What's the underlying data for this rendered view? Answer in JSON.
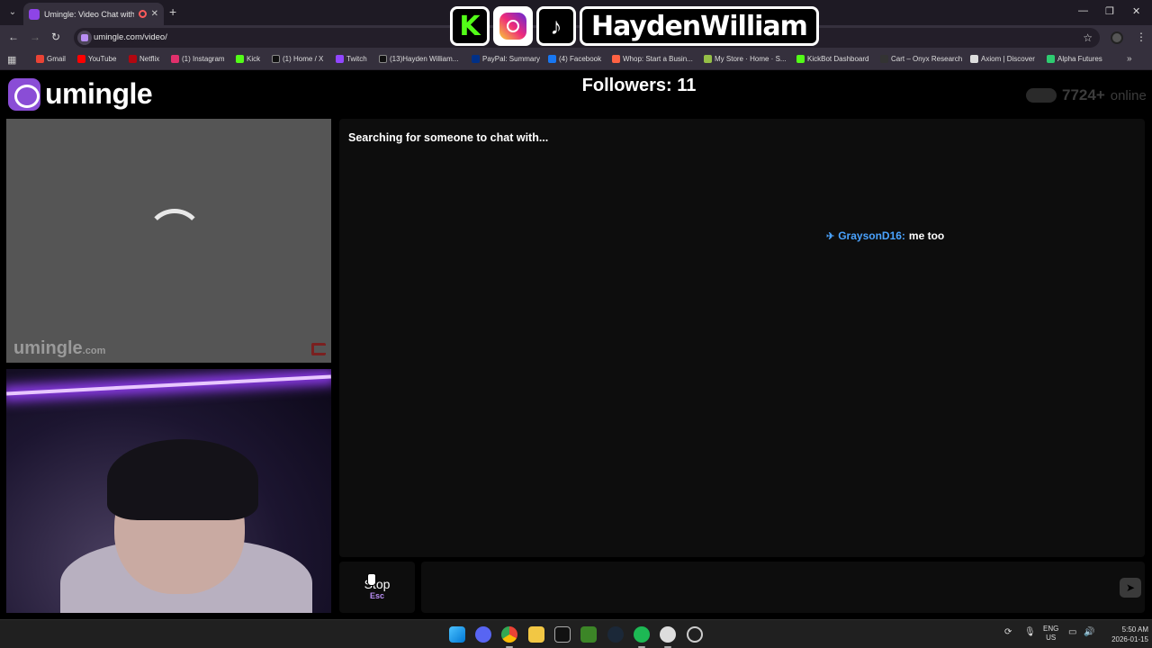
{
  "browser": {
    "tab_title": "Umingle: Video Chat with S",
    "url": "umingle.com/video/",
    "bookmarks": [
      "Gmail",
      "YouTube",
      "Netflix",
      "(1) Instagram",
      "Kick",
      "(1) Home / X",
      "Twitch",
      "(13)Hayden William...",
      "PayPal: Summary",
      "(4) Facebook",
      "Whop: Start a Busin...",
      "My Store · Home · S...",
      "KickBot Dashboard",
      "Cart – Onyx Research",
      "Axiom | Discover",
      "Alpha Futures"
    ]
  },
  "overlay": {
    "kick_letter": "K",
    "tiktok_glyph": "♪",
    "name": "HaydenWilliam"
  },
  "header": {
    "logo_text": "umingle",
    "followers": "Followers: 11",
    "online_count": "7724+",
    "online_label": "online"
  },
  "stranger_video": {
    "watermark": "umingle",
    "watermark_suffix": ".com"
  },
  "chat": {
    "status": "Searching for someone to chat with...",
    "message_user": "GraysonD16:",
    "message_text": "me too"
  },
  "controls": {
    "stop_label": "Stop",
    "stop_key": "Esc"
  },
  "taskbar": {
    "lang_top": "ENG",
    "lang_bottom": "US",
    "time": "5:50 AM",
    "date": "2026-01-15"
  },
  "colors": {
    "brand": "#8a4dd6",
    "chat_user": "#4aa3ff",
    "panel_bg": "#0d0d0d"
  }
}
